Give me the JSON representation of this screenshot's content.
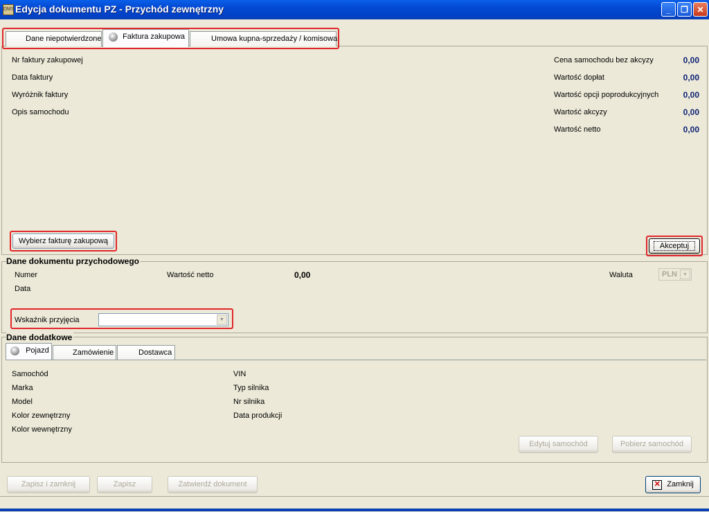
{
  "window": {
    "title": "Edycja dokumentu PZ - Przychód zewnętrzny",
    "icon_label": "DMS",
    "controls": [
      "minimize-icon",
      "restore-icon",
      "close-icon"
    ]
  },
  "top_tabs": [
    {
      "label": "Dane niepotwierdzone",
      "active": false
    },
    {
      "label": "Faktura zakupowa",
      "active": true
    },
    {
      "label": "Umowa kupna-sprzedaży / komisowa",
      "active": false
    }
  ],
  "invoice": {
    "left_fields": [
      "Nr faktury zakupowej",
      "Data faktury",
      "Wyróżnik faktury",
      "Opis samochodu"
    ],
    "right_fields": [
      {
        "label": "Cena samochodu bez akcyzy",
        "value": "0,00"
      },
      {
        "label": "Wartość dopłat",
        "value": "0,00"
      },
      {
        "label": "Wartość opcji poprodukcyjnych",
        "value": "0,00"
      },
      {
        "label": "Wartość akcyzy",
        "value": "0,00"
      },
      {
        "label": "Wartość netto",
        "value": "0,00"
      }
    ],
    "choose_button": "Wybierz fakturę zakupową",
    "accept_button": "Akceptuj"
  },
  "income_doc": {
    "title": "Dane dokumentu przychodowego",
    "numer_label": "Numer",
    "data_label": "Data",
    "netto_label": "Wartość netto",
    "netto_value": "0,00",
    "waluta_label": "Waluta",
    "waluta_value": "PLN",
    "wskaznik_label": "Wskaźnik przyjęcia",
    "wskaznik_value": ""
  },
  "additional": {
    "title": "Dane dodatkowe",
    "tabs": [
      {
        "label": "Pojazd",
        "active": true
      },
      {
        "label": "Zamówienie",
        "active": false
      },
      {
        "label": "Dostawca",
        "active": false
      }
    ],
    "left_fields": [
      "Samochód",
      "Marka",
      "Model",
      "Kolor zewnętrzny",
      "Kolor wewnętrzny"
    ],
    "right_fields": [
      "VIN",
      "Typ silnika",
      "Nr silnika",
      "Data produkcji"
    ],
    "edit_button": "Edytuj samochód",
    "fetch_button": "Pobierz samochód"
  },
  "footer": {
    "save_close": "Zapisz i zamknij",
    "save": "Zapisz",
    "confirm": "Zatwierdź dokument",
    "close": "Zamknij"
  }
}
